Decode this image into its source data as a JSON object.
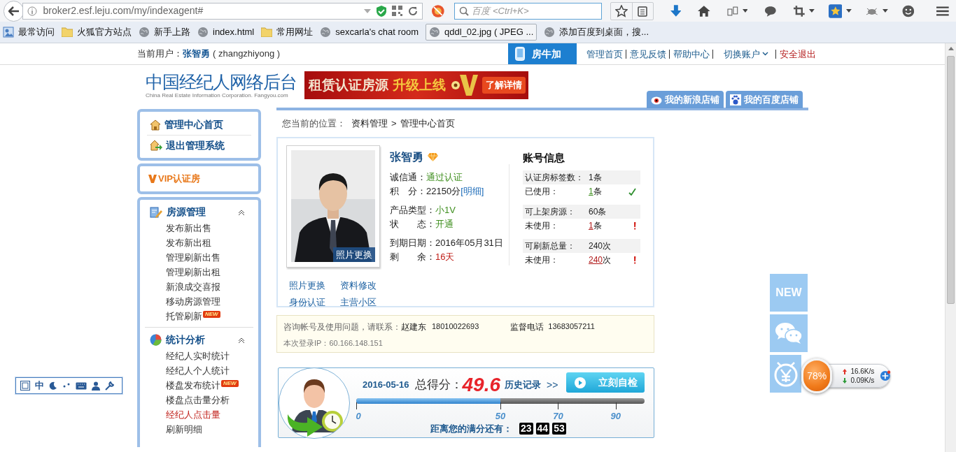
{
  "browser": {
    "url": "broker2.esf.leju.com/my/indexagent#",
    "search_placeholder": "百度 <Ctrl+K>"
  },
  "bookmarks": [
    {
      "label": "最常访问",
      "kind": "frequent"
    },
    {
      "label": "火狐官方站点",
      "kind": "folder"
    },
    {
      "label": "新手上路",
      "kind": "globe"
    },
    {
      "label": "index.html",
      "kind": "globe"
    },
    {
      "label": "常用网址",
      "kind": "folder"
    },
    {
      "label": "sexcarla's chat room",
      "kind": "globe"
    },
    {
      "label": "qddl_02.jpg ( JPEG ...",
      "kind": "boxed"
    },
    {
      "label": "添加百度到桌面，搜...",
      "kind": "globe"
    }
  ],
  "topbar": {
    "user_label": "当前用户：",
    "user_name": "张智勇",
    "user_id": "( zhangzhiyong )",
    "brand": "房牛加",
    "links": [
      {
        "label": "管理首页",
        "kind": "link"
      },
      {
        "label": "意见反馈",
        "kind": "link"
      },
      {
        "label": "帮助中心",
        "kind": "link"
      },
      {
        "label": "切换账户",
        "kind": "dropdown"
      },
      {
        "label": "安全退出",
        "kind": "logout"
      }
    ]
  },
  "header": {
    "logo_title": "中国经纪人网络后台",
    "logo_subtitle": "China Real Estate Information Corporation. Fangyou.com",
    "banner": {
      "headline": "租赁认证房源",
      "tagline": "升级上线",
      "button": "了解详情"
    },
    "shop_tabs": [
      {
        "label": "我的新浪店铺",
        "kind": "sina"
      },
      {
        "label": "我的百度店铺",
        "kind": "baidu"
      }
    ]
  },
  "sidebar": {
    "top_links": [
      {
        "label": "管理中心首页",
        "kind": "home"
      },
      {
        "label": "退出管理系统",
        "kind": "exit"
      }
    ],
    "vip": "VIP认证房",
    "sections": [
      {
        "title": "房源管理",
        "kind": "edit",
        "expanded": true,
        "items": [
          {
            "label": "发布新出售",
            "selected": false
          },
          {
            "label": "发布新出租",
            "selected": false
          },
          {
            "label": "管理刷新出售",
            "selected": false
          },
          {
            "label": "管理刷新出租",
            "selected": false
          },
          {
            "label": "新浪成交喜报",
            "selected": false
          },
          {
            "label": "移动房源管理",
            "selected": false
          },
          {
            "label": "托管刷新",
            "selected": false,
            "badge": "NEW"
          }
        ]
      },
      {
        "title": "统计分析",
        "kind": "pie",
        "expanded": true,
        "items": [
          {
            "label": "经纪人实时统计",
            "selected": false
          },
          {
            "label": "经纪人个人统计",
            "selected": false
          },
          {
            "label": "楼盘发布统计",
            "selected": false,
            "badge": "NEW"
          },
          {
            "label": "楼盘点击量分析",
            "selected": false
          },
          {
            "label": "经纪人点击量",
            "selected": true
          },
          {
            "label": "刷新明细",
            "selected": false
          }
        ]
      }
    ]
  },
  "content": {
    "breadcrumb_label": "您当前的位置：",
    "breadcrumb": [
      "资料管理",
      "管理中心首页"
    ],
    "breadcrumb_separator": ">",
    "profile": {
      "photo_button": "照片更换",
      "links": [
        "照片更换",
        "资料修改",
        "身份认证",
        "主营小区"
      ],
      "name": "张智勇",
      "info_groups": [
        [
          {
            "label": "诚信通：",
            "value": "通过认证",
            "color": "#3f8f1f"
          },
          {
            "label": "积　分：",
            "value": "22150分",
            "color": "#222222",
            "link": "[明细]"
          }
        ],
        [
          {
            "label": "产品类型：",
            "value": "小1V",
            "color": "#3f8f1f"
          },
          {
            "label": "状　　态：",
            "value": "开通",
            "color": "#3f8f1f"
          }
        ],
        [
          {
            "label": "到期日期：",
            "value": "2016年05月31日",
            "color": "#222222"
          },
          {
            "label": "剩　　余：",
            "value": "16天",
            "color": "#c0201a"
          }
        ]
      ]
    },
    "account": {
      "title": "账号信息",
      "groups": [
        [
          {
            "label": "认证房标签数：",
            "count": "1",
            "unit": "条",
            "color": "#222222",
            "underline": false,
            "kind": "plain"
          },
          {
            "label": "已使用：",
            "count": "1",
            "unit": "条",
            "color": "#3f8f1f",
            "underline": true,
            "kind": "check"
          }
        ],
        [
          {
            "label": "可上架房源：",
            "count": "60",
            "unit": "条",
            "color": "#222222",
            "underline": false,
            "kind": "plain"
          },
          {
            "label": "未使用：",
            "count": "1",
            "unit": "条",
            "color": "#b01818",
            "underline": true,
            "kind": "alert"
          }
        ],
        [
          {
            "label": "可刷新总量：",
            "count": "240",
            "unit": "次",
            "color": "#222222",
            "underline": false,
            "kind": "plain"
          },
          {
            "label": "未使用：",
            "count": "240",
            "unit": "次",
            "color": "#b01818",
            "underline": true,
            "kind": "alert"
          }
        ]
      ]
    },
    "notice": {
      "contact_label": "咨询帐号及使用问题，请联系：",
      "contact_name": "赵建东",
      "contact_phone": "18010022693",
      "supervise_label": "监督电话",
      "supervise_phone": "13683057211",
      "login_ip": "本次登录IP：60.166.148.151"
    },
    "score": {
      "date": "2016-05-16",
      "label": "总得分：",
      "value": "49.6",
      "history": "历史记录",
      "arrows": ">>",
      "button": "立刻自检",
      "level": 0.5,
      "ticks": [
        "0",
        "50",
        "70",
        "90"
      ],
      "countdown_label": "距离您的满分还有：",
      "countdown": [
        "23",
        "44",
        "53"
      ]
    }
  },
  "widgets": {
    "new_label": "NEW",
    "speed": {
      "percent": "78%",
      "up": "16.6K/s",
      "down": "0.09K/s"
    },
    "ime": "中"
  }
}
